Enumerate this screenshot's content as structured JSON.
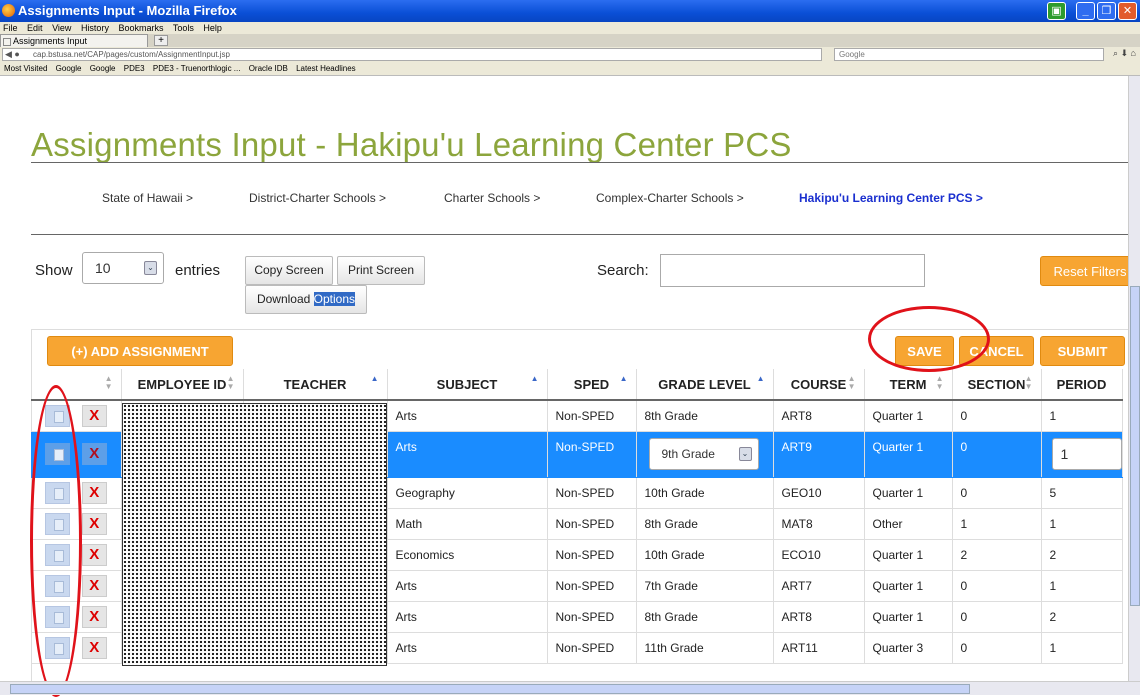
{
  "window": {
    "title": "Assignments Input - Mozilla Firefox"
  },
  "menu": [
    "File",
    "Edit",
    "View",
    "History",
    "Bookmarks",
    "Tools",
    "Help"
  ],
  "tab": {
    "label": "Assignments Input",
    "new_tab": "+"
  },
  "nav": {
    "url": "cap.bstusa.net/CAP/pages/custom/AssignmentInput.jsp",
    "search_placeholder": "Google"
  },
  "bookmarks": [
    "Most Visited",
    "Google",
    "Google",
    "PDE3",
    "PDE3 - Truenorthlogic ...",
    "Oracle IDB",
    "Latest Headlines"
  ],
  "page_title": "Assignments Input - Hakipu'u Learning Center PCS",
  "breadcrumbs": [
    "State of Hawaii >",
    "District-Charter Schools >",
    "Charter Schools >",
    "Complex-Charter Schools >",
    "Hakipu'u Learning Center PCS >"
  ],
  "controls": {
    "show_label": "Show",
    "entries_value": "10",
    "entries_label": "entries",
    "copy_screen": "Copy Screen",
    "print_screen": "Print Screen",
    "download_prefix": "Download",
    "download_highlight": "Options",
    "search_label": "Search:",
    "reset_filters": "Reset Filters"
  },
  "actions": {
    "add_assignment": "(+) ADD ASSIGNMENT",
    "save": "SAVE",
    "cancel": "CANCEL",
    "submit": "SUBMIT"
  },
  "table": {
    "headers": [
      "EMPLOYEE ID",
      "TEACHER",
      "SUBJECT",
      "SPED",
      "GRADE LEVEL",
      "COURSE",
      "TERM",
      "SECTION",
      "PERIOD"
    ],
    "delete_symbol": "X",
    "rows": [
      {
        "subject": "Arts",
        "sped": "Non-SPED",
        "grade": "8th Grade",
        "course": "ART8",
        "term": "Quarter 1",
        "section": "0",
        "period": "1"
      },
      {
        "subject": "Arts",
        "sped": "Non-SPED",
        "grade": "9th Grade",
        "course": "ART9",
        "term": "Quarter 1",
        "section": "0",
        "period": "1"
      },
      {
        "subject": "Geography",
        "sped": "Non-SPED",
        "grade": "10th Grade",
        "course": "GEO10",
        "term": "Quarter 1",
        "section": "0",
        "period": "5"
      },
      {
        "subject": "Math",
        "sped": "Non-SPED",
        "grade": "8th Grade",
        "course": "MAT8",
        "term": "Other",
        "section": "1",
        "period": "1"
      },
      {
        "subject": "Economics",
        "sped": "Non-SPED",
        "grade": "10th Grade",
        "course": "ECO10",
        "term": "Quarter 1",
        "section": "2",
        "period": "2"
      },
      {
        "subject": "Arts",
        "sped": "Non-SPED",
        "grade": "7th Grade",
        "course": "ART7",
        "term": "Quarter 1",
        "section": "0",
        "period": "1"
      },
      {
        "subject": "Arts",
        "sped": "Non-SPED",
        "grade": "8th Grade",
        "course": "ART8",
        "term": "Quarter 1",
        "section": "0",
        "period": "2"
      },
      {
        "subject": "Arts",
        "sped": "Non-SPED",
        "grade": "11th Grade",
        "course": "ART11",
        "term": "Quarter 3",
        "section": "0",
        "period": "1"
      }
    ]
  },
  "colors": {
    "title_green": "#8ca53c",
    "accent_orange": "#f7a532",
    "selected_row": "#1a8cff",
    "annotation_red": "#e0121a"
  }
}
